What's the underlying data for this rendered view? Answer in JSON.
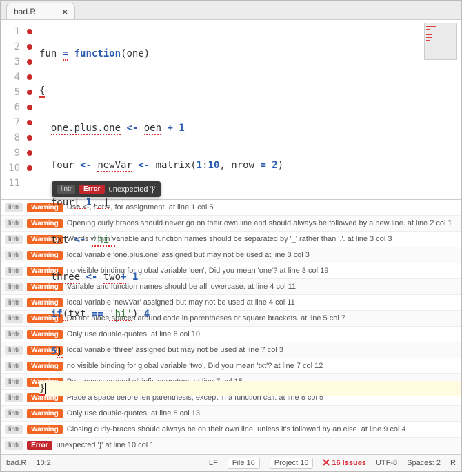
{
  "tab": {
    "title": "bad.R"
  },
  "code_lines": [
    {
      "n": 1,
      "marker": true
    },
    {
      "n": 2,
      "marker": true
    },
    {
      "n": 3,
      "marker": true
    },
    {
      "n": 4,
      "marker": true
    },
    {
      "n": 5,
      "marker": true
    },
    {
      "n": 6,
      "marker": true
    },
    {
      "n": 7,
      "marker": true
    },
    {
      "n": 8,
      "marker": true
    },
    {
      "n": 9,
      "marker": true
    },
    {
      "n": 10,
      "marker": true,
      "highlight": true
    },
    {
      "n": 11,
      "marker": false
    }
  ],
  "tooltip": {
    "source": "lintr",
    "level": "Error",
    "message": "unexpected '}'"
  },
  "issues": [
    {
      "source": "lintr",
      "level": "Warning",
      "message": "Use <-, not =, for assignment. at line 1 col 5"
    },
    {
      "source": "lintr",
      "level": "Warning",
      "message": "Opening curly braces should never go on their own line and should always be followed by a new line. at line 2 col 1"
    },
    {
      "source": "lintr",
      "level": "Warning",
      "message": "Words within variable and function names should be separated by '_' rather than '.'. at line 3 col 3"
    },
    {
      "source": "lintr",
      "level": "Warning",
      "message": "local variable 'one.plus.one' assigned but may not be used at line 3 col 3"
    },
    {
      "source": "lintr",
      "level": "Warning",
      "message": "no visible binding for global variable 'oen', Did you mean 'one'? at line 3 col 19"
    },
    {
      "source": "lintr",
      "level": "Warning",
      "message": "Variable and function names should be all lowercase. at line 4 col 11"
    },
    {
      "source": "lintr",
      "level": "Warning",
      "message": "local variable 'newVar' assigned but may not be used at line 4 col 11"
    },
    {
      "source": "lintr",
      "level": "Warning",
      "message": "Do not place spaces around code in parentheses or square brackets. at line 5 col 7"
    },
    {
      "source": "lintr",
      "level": "Warning",
      "message": "Only use double-quotes. at line 6 col 10"
    },
    {
      "source": "lintr",
      "level": "Warning",
      "message": "local variable 'three' assigned but may not be used at line 7 col 3"
    },
    {
      "source": "lintr",
      "level": "Warning",
      "message": "no visible binding for global variable 'two', Did you mean 'txt'? at line 7 col 12"
    },
    {
      "source": "lintr",
      "level": "Warning",
      "message": "Put spaces around all infix operators. at line 7 col 15"
    },
    {
      "source": "lintr",
      "level": "Warning",
      "message": "Place a space before left parenthesis, except in a function call. at line 8 col 5"
    },
    {
      "source": "lintr",
      "level": "Warning",
      "message": "Only use double-quotes. at line 8 col 13"
    },
    {
      "source": "lintr",
      "level": "Warning",
      "message": "Closing curly-braces should always be on their own line, unless it's followed by an else. at line 9 col 4"
    },
    {
      "source": "lintr",
      "level": "Error",
      "message": "unexpected '}' at line 10 col 1"
    }
  ],
  "status": {
    "filename": "bad.R",
    "cursor": "10:2",
    "line_ending": "LF",
    "file_count_label": "File",
    "file_count": "16",
    "project_count_label": "Project",
    "project_count": "16",
    "issues_label": "16 Issues",
    "encoding": "UTF-8",
    "spaces_label": "Spaces:",
    "spaces": "2",
    "language": "R"
  }
}
